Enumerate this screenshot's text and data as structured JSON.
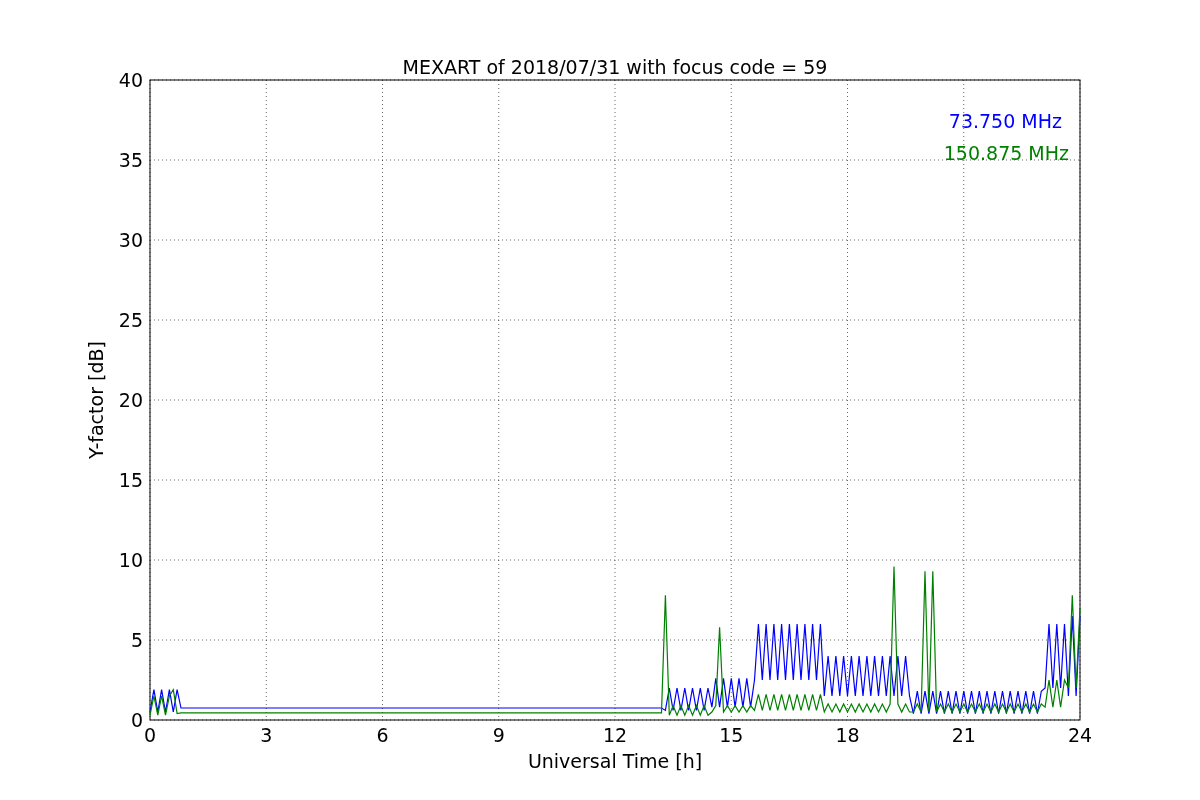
{
  "figure": {
    "chart_data": {
      "type": "line",
      "title": "MEXART of 2018/07/31 with focus code = 59",
      "xlabel": "Universal Time [h]",
      "ylabel": "Y-factor [dB]",
      "x": [
        0,
        0.1,
        0.2,
        0.3,
        0.4,
        0.5,
        0.6,
        0.7,
        0.8,
        13.2,
        13.3,
        13.4,
        13.5,
        13.6,
        13.7,
        13.8,
        13.9,
        14.0,
        14.1,
        14.2,
        14.3,
        14.4,
        14.5,
        14.6,
        14.7,
        14.8,
        14.9,
        15.0,
        15.1,
        15.2,
        15.3,
        15.4,
        15.5,
        15.6,
        15.7,
        15.8,
        15.9,
        16.0,
        16.1,
        16.2,
        16.3,
        16.4,
        16.5,
        16.6,
        16.7,
        16.8,
        16.9,
        17.0,
        17.1,
        17.2,
        17.3,
        17.4,
        17.5,
        17.6,
        17.7,
        17.8,
        17.9,
        18.0,
        18.1,
        18.2,
        18.3,
        18.4,
        18.5,
        18.6,
        18.7,
        18.8,
        18.9,
        19.0,
        19.1,
        19.2,
        19.3,
        19.4,
        19.5,
        19.6,
        19.7,
        19.8,
        19.9,
        20.0,
        20.1,
        20.2,
        20.3,
        20.4,
        20.5,
        20.6,
        20.7,
        20.8,
        20.9,
        21.0,
        21.1,
        21.2,
        21.3,
        21.4,
        21.5,
        21.6,
        21.7,
        21.8,
        21.9,
        22.0,
        22.1,
        22.2,
        22.3,
        22.4,
        22.5,
        22.6,
        22.7,
        22.8,
        22.9,
        23.0,
        23.1,
        23.2,
        23.3,
        23.4,
        23.5,
        23.6,
        23.7,
        23.8,
        23.9,
        24.0
      ],
      "series": [
        {
          "name": "73.750 MHz",
          "color": "#0000ff",
          "values": [
            0.5,
            1.9,
            0.5,
            1.9,
            0.5,
            1.9,
            0.5,
            1.9,
            0.75,
            0.75,
            0.6,
            2.0,
            0.6,
            2.0,
            0.6,
            2.0,
            0.6,
            2.0,
            0.6,
            2.0,
            0.6,
            2.0,
            0.8,
            2.6,
            0.8,
            2.6,
            0.8,
            2.6,
            0.8,
            2.6,
            0.8,
            2.6,
            0.8,
            2.5,
            6.0,
            2.5,
            6.0,
            2.5,
            6.0,
            2.5,
            6.0,
            2.5,
            6.0,
            2.5,
            6.0,
            2.5,
            6.0,
            2.5,
            6.0,
            2.5,
            6.0,
            1.5,
            4.0,
            1.5,
            4.0,
            1.5,
            4.0,
            1.5,
            4.0,
            1.5,
            4.0,
            1.5,
            4.0,
            1.5,
            4.0,
            1.5,
            4.0,
            1.5,
            4.0,
            1.5,
            4.0,
            1.5,
            4.0,
            1.5,
            0.4,
            1.8,
            0.4,
            1.8,
            0.4,
            1.8,
            0.4,
            1.8,
            0.4,
            1.8,
            0.4,
            1.8,
            0.4,
            1.8,
            0.4,
            1.8,
            0.4,
            1.8,
            0.4,
            1.8,
            0.4,
            1.8,
            0.4,
            1.8,
            0.4,
            1.8,
            0.4,
            1.8,
            0.4,
            1.8,
            0.4,
            1.8,
            0.4,
            1.8,
            2.0,
            6.0,
            2.0,
            6.0,
            2.0,
            6.0,
            1.5,
            6.5,
            1.5,
            6.5
          ]
        },
        {
          "name": "150.875 MHz",
          "color": "#008000",
          "values": [
            0.3,
            1.5,
            0.3,
            1.5,
            0.3,
            1.5,
            1.9,
            0.4,
            0.45,
            0.45,
            7.8,
            0.3,
            0.9,
            0.3,
            0.9,
            0.3,
            0.9,
            0.3,
            0.9,
            0.3,
            0.9,
            0.3,
            0.5,
            0.9,
            5.8,
            0.5,
            0.9,
            0.5,
            0.9,
            0.5,
            0.9,
            0.5,
            0.9,
            0.6,
            1.6,
            0.6,
            1.6,
            0.6,
            1.6,
            0.6,
            1.6,
            0.6,
            1.6,
            0.6,
            1.6,
            0.6,
            1.6,
            0.6,
            1.6,
            0.6,
            1.6,
            0.5,
            1.0,
            0.5,
            1.0,
            0.5,
            1.0,
            0.5,
            1.0,
            0.5,
            1.0,
            0.5,
            1.0,
            0.5,
            1.0,
            0.5,
            1.0,
            0.5,
            1.0,
            9.6,
            1.0,
            0.5,
            1.0,
            0.5,
            0.5,
            1.0,
            0.5,
            9.3,
            0.5,
            9.3,
            0.5,
            1.0,
            0.5,
            1.0,
            0.5,
            1.0,
            0.5,
            1.0,
            0.5,
            1.0,
            0.5,
            1.0,
            0.5,
            1.0,
            0.5,
            1.0,
            0.5,
            1.0,
            0.5,
            1.0,
            0.5,
            1.0,
            0.5,
            1.0,
            0.5,
            1.0,
            0.5,
            1.0,
            0.8,
            2.5,
            0.8,
            2.5,
            0.8,
            2.5,
            2,
            7.8,
            2,
            7
          ]
        }
      ],
      "grid": true,
      "xlim": [
        0,
        24
      ],
      "ylim": [
        0,
        40
      ],
      "xticks": [
        0,
        3,
        6,
        9,
        12,
        15,
        18,
        21,
        24
      ],
      "yticks": [
        0,
        5,
        10,
        15,
        20,
        25,
        30,
        35,
        40
      ]
    }
  }
}
